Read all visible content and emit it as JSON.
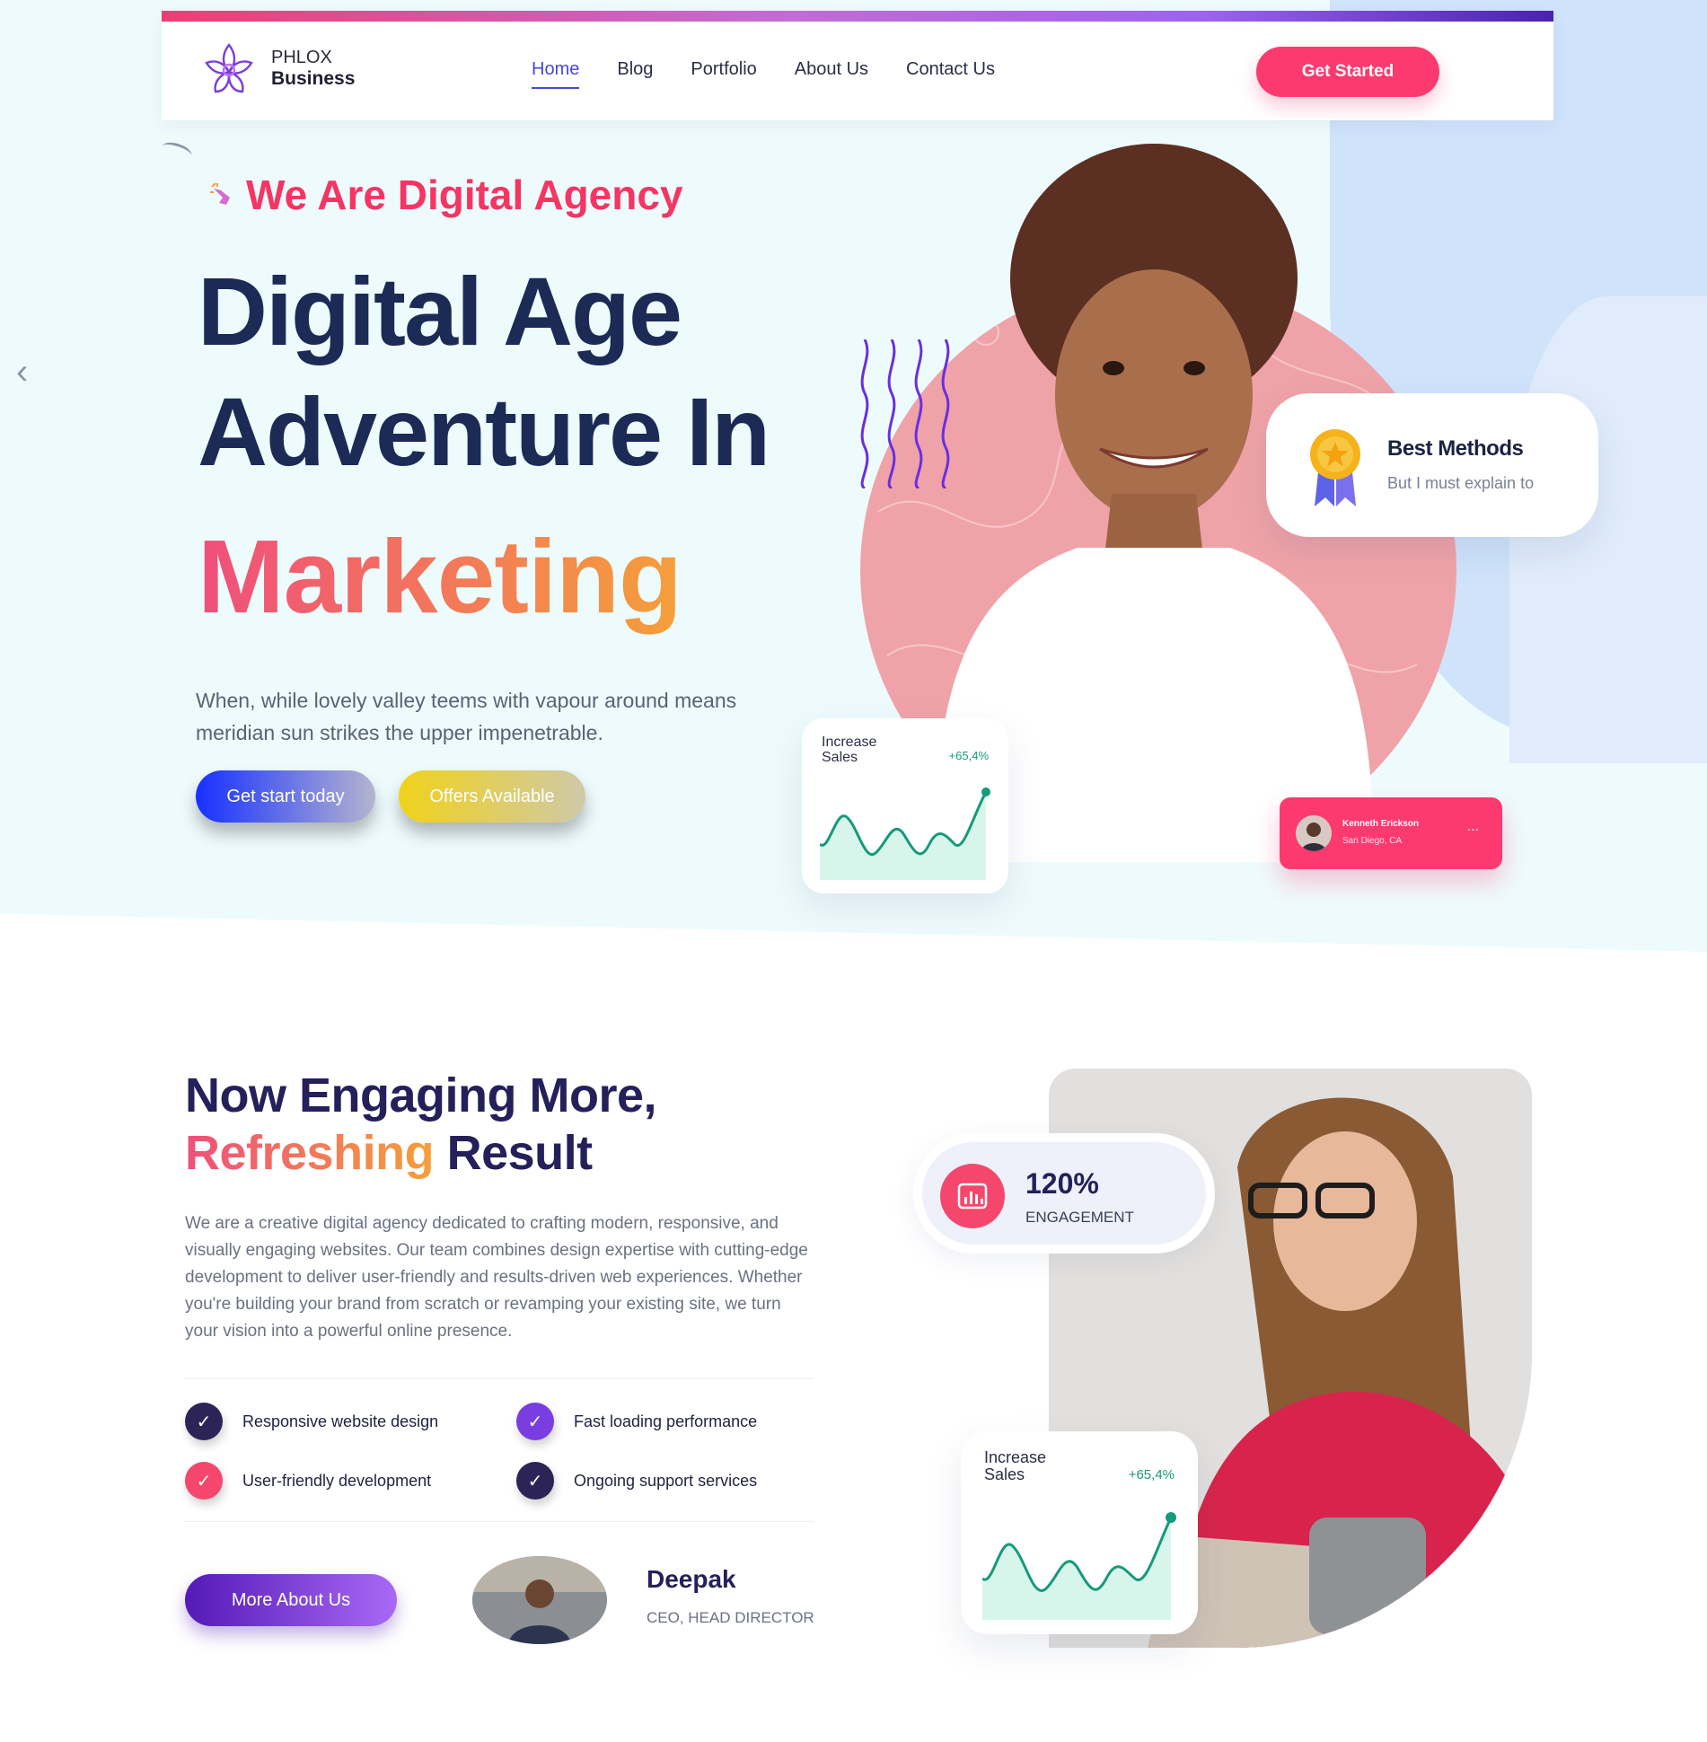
{
  "brand": {
    "line1": "PHLOX",
    "line2": "Business",
    "logo_icon": "lotus-logo-icon"
  },
  "nav": {
    "items": [
      {
        "label": "Home",
        "active": true
      },
      {
        "label": "Blog",
        "active": false
      },
      {
        "label": "Portfolio",
        "active": false
      },
      {
        "label": "About Us",
        "active": false
      },
      {
        "label": "Contact Us",
        "active": false
      }
    ],
    "cta": "Get Started"
  },
  "hero": {
    "eyebrow": "We Are Digital Agency",
    "title_line1": "Digital Age",
    "title_line2": "Adventure In",
    "title_accent": "Marketing",
    "description": "When, while lovely valley teems with vapour around means meridian sun strikes the upper impenetrable.",
    "primary_button": "Get start today",
    "secondary_button": "Offers Available"
  },
  "best_methods": {
    "title": "Best Methods",
    "subtitle": "But I must explain to",
    "icon": "medal-icon"
  },
  "sales_card": {
    "label": "Increase\nSales",
    "delta": "+65,4%"
  },
  "person_card": {
    "name": "Kenneth Erickson",
    "location": "San Diego, CA",
    "more": "..."
  },
  "about": {
    "title_line1": "Now Engaging More,",
    "title_highlight": "Refreshing",
    "title_rest": " Result",
    "description": "We are a creative digital agency dedicated to crafting modern, responsive, and visually engaging websites. Our team combines design expertise with cutting-edge development to deliver user-friendly and results-driven web experiences. Whether you're building your brand from scratch or revamping your existing site, we turn your vision into a powerful online presence.",
    "features": [
      {
        "label": "Responsive website design",
        "color": "#2c2456"
      },
      {
        "label": "Fast loading performance",
        "color": "#7a3ee0"
      },
      {
        "label": "User-friendly development",
        "color": "#f5476d"
      },
      {
        "label": "Ongoing support services",
        "color": "#2c2456"
      }
    ],
    "button": "More About Us",
    "ceo": {
      "name": "Deepak",
      "role": "CEO, HEAD DIRECTOR"
    }
  },
  "stat": {
    "value": "120%",
    "label": "ENGAGEMENT",
    "icon": "bar-chart-icon"
  },
  "sales_card2": {
    "label": "Increase\nSales",
    "delta": "+65,4%"
  },
  "colors": {
    "accent_pink": "#fc3a6f",
    "navy": "#1b2b55",
    "purple": "#4b46d6",
    "chart_green": "#169a7a"
  }
}
